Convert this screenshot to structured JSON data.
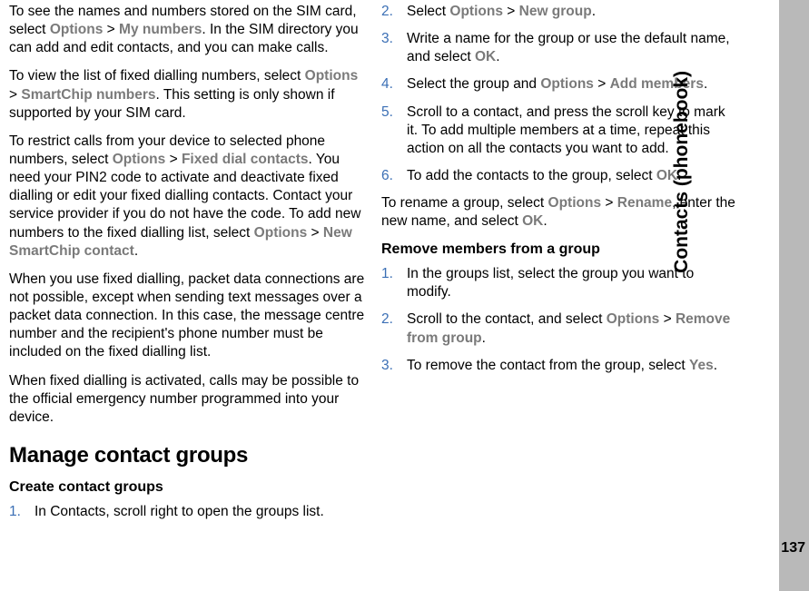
{
  "sidebar": {
    "section_title": "Contacts (phonebook)",
    "page_number": "137"
  },
  "col1": {
    "p1_a": "To see the names and numbers stored on the SIM card, select ",
    "p1_opt": "Options",
    "p1_sep": " > ",
    "p1_my": "My numbers",
    "p1_b": ". In the SIM directory you can add and edit contacts, and you can make calls.",
    "p2_a": "To view the list of fixed dialling numbers, select ",
    "p2_opt": "Options",
    "p2_sep": " > ",
    "p2_sc": "SmartChip numbers",
    "p2_b": ". This setting is only shown if supported by your SIM card.",
    "p3_a": "To restrict calls from your device to selected phone numbers, select ",
    "p3_opt": "Options",
    "p3_sep": " > ",
    "p3_fdc": "Fixed dial contacts",
    "p3_b": ". You need your PIN2 code to activate and deactivate fixed dialling or edit your fixed dialling contacts. Contact your service provider if you do not have the code. To add new numbers to the fixed dialling list, select ",
    "p3_opt2": "Options",
    "p3_sep2": " > ",
    "p3_nsc": "New SmartChip contact",
    "p3_c": ".",
    "p4": "When you use fixed dialling, packet data connections are not possible, except when sending text messages over a packet data connection. In this case, the message centre number and the recipient's phone number must be included on the fixed dialling list.",
    "p5": "When fixed dialling is activated, calls may be possible to the official emergency number programmed into your device.",
    "h2": "Manage contact groups",
    "h3": "Create contact groups",
    "li1_num": "1.",
    "li1": "In Contacts, scroll right to open the groups list."
  },
  "col2": {
    "li2_num": "2.",
    "li2_a": "Select ",
    "li2_opt": "Options",
    "li2_sep": " > ",
    "li2_ng": "New group",
    "li2_b": ".",
    "li3_num": "3.",
    "li3_a": "Write a name for the group or use the default name, and select ",
    "li3_ok": "OK",
    "li3_b": ".",
    "li4_num": "4.",
    "li4_a": "Select the group and ",
    "li4_opt": "Options",
    "li4_sep": " > ",
    "li4_am": "Add members",
    "li4_b": ".",
    "li5_num": "5.",
    "li5": "Scroll to a contact, and press the scroll key to mark it. To add multiple members at a time, repeat this action on all the contacts you want to add.",
    "li6_num": "6.",
    "li6_a": "To add the contacts to the group, select ",
    "li6_ok": "OK",
    "li6_b": ".",
    "p_rename_a": "To rename a group, select ",
    "p_rename_opt": "Options",
    "p_rename_sep": " > ",
    "p_rename_rn": "Rename",
    "p_rename_b": ", enter the new name, and select ",
    "p_rename_ok": "OK",
    "p_rename_c": ".",
    "h3_remove": "Remove members from a group",
    "r1_num": "1.",
    "r1": "In the groups list, select the group you want to modify.",
    "r2_num": "2.",
    "r2_a": "Scroll to the contact, and select ",
    "r2_opt": "Options",
    "r2_sep": " > ",
    "r2_rfg": "Remove from group",
    "r2_b": ".",
    "r3_num": "3.",
    "r3_a": "To remove the contact from the group, select ",
    "r3_yes": "Yes",
    "r3_b": "."
  }
}
